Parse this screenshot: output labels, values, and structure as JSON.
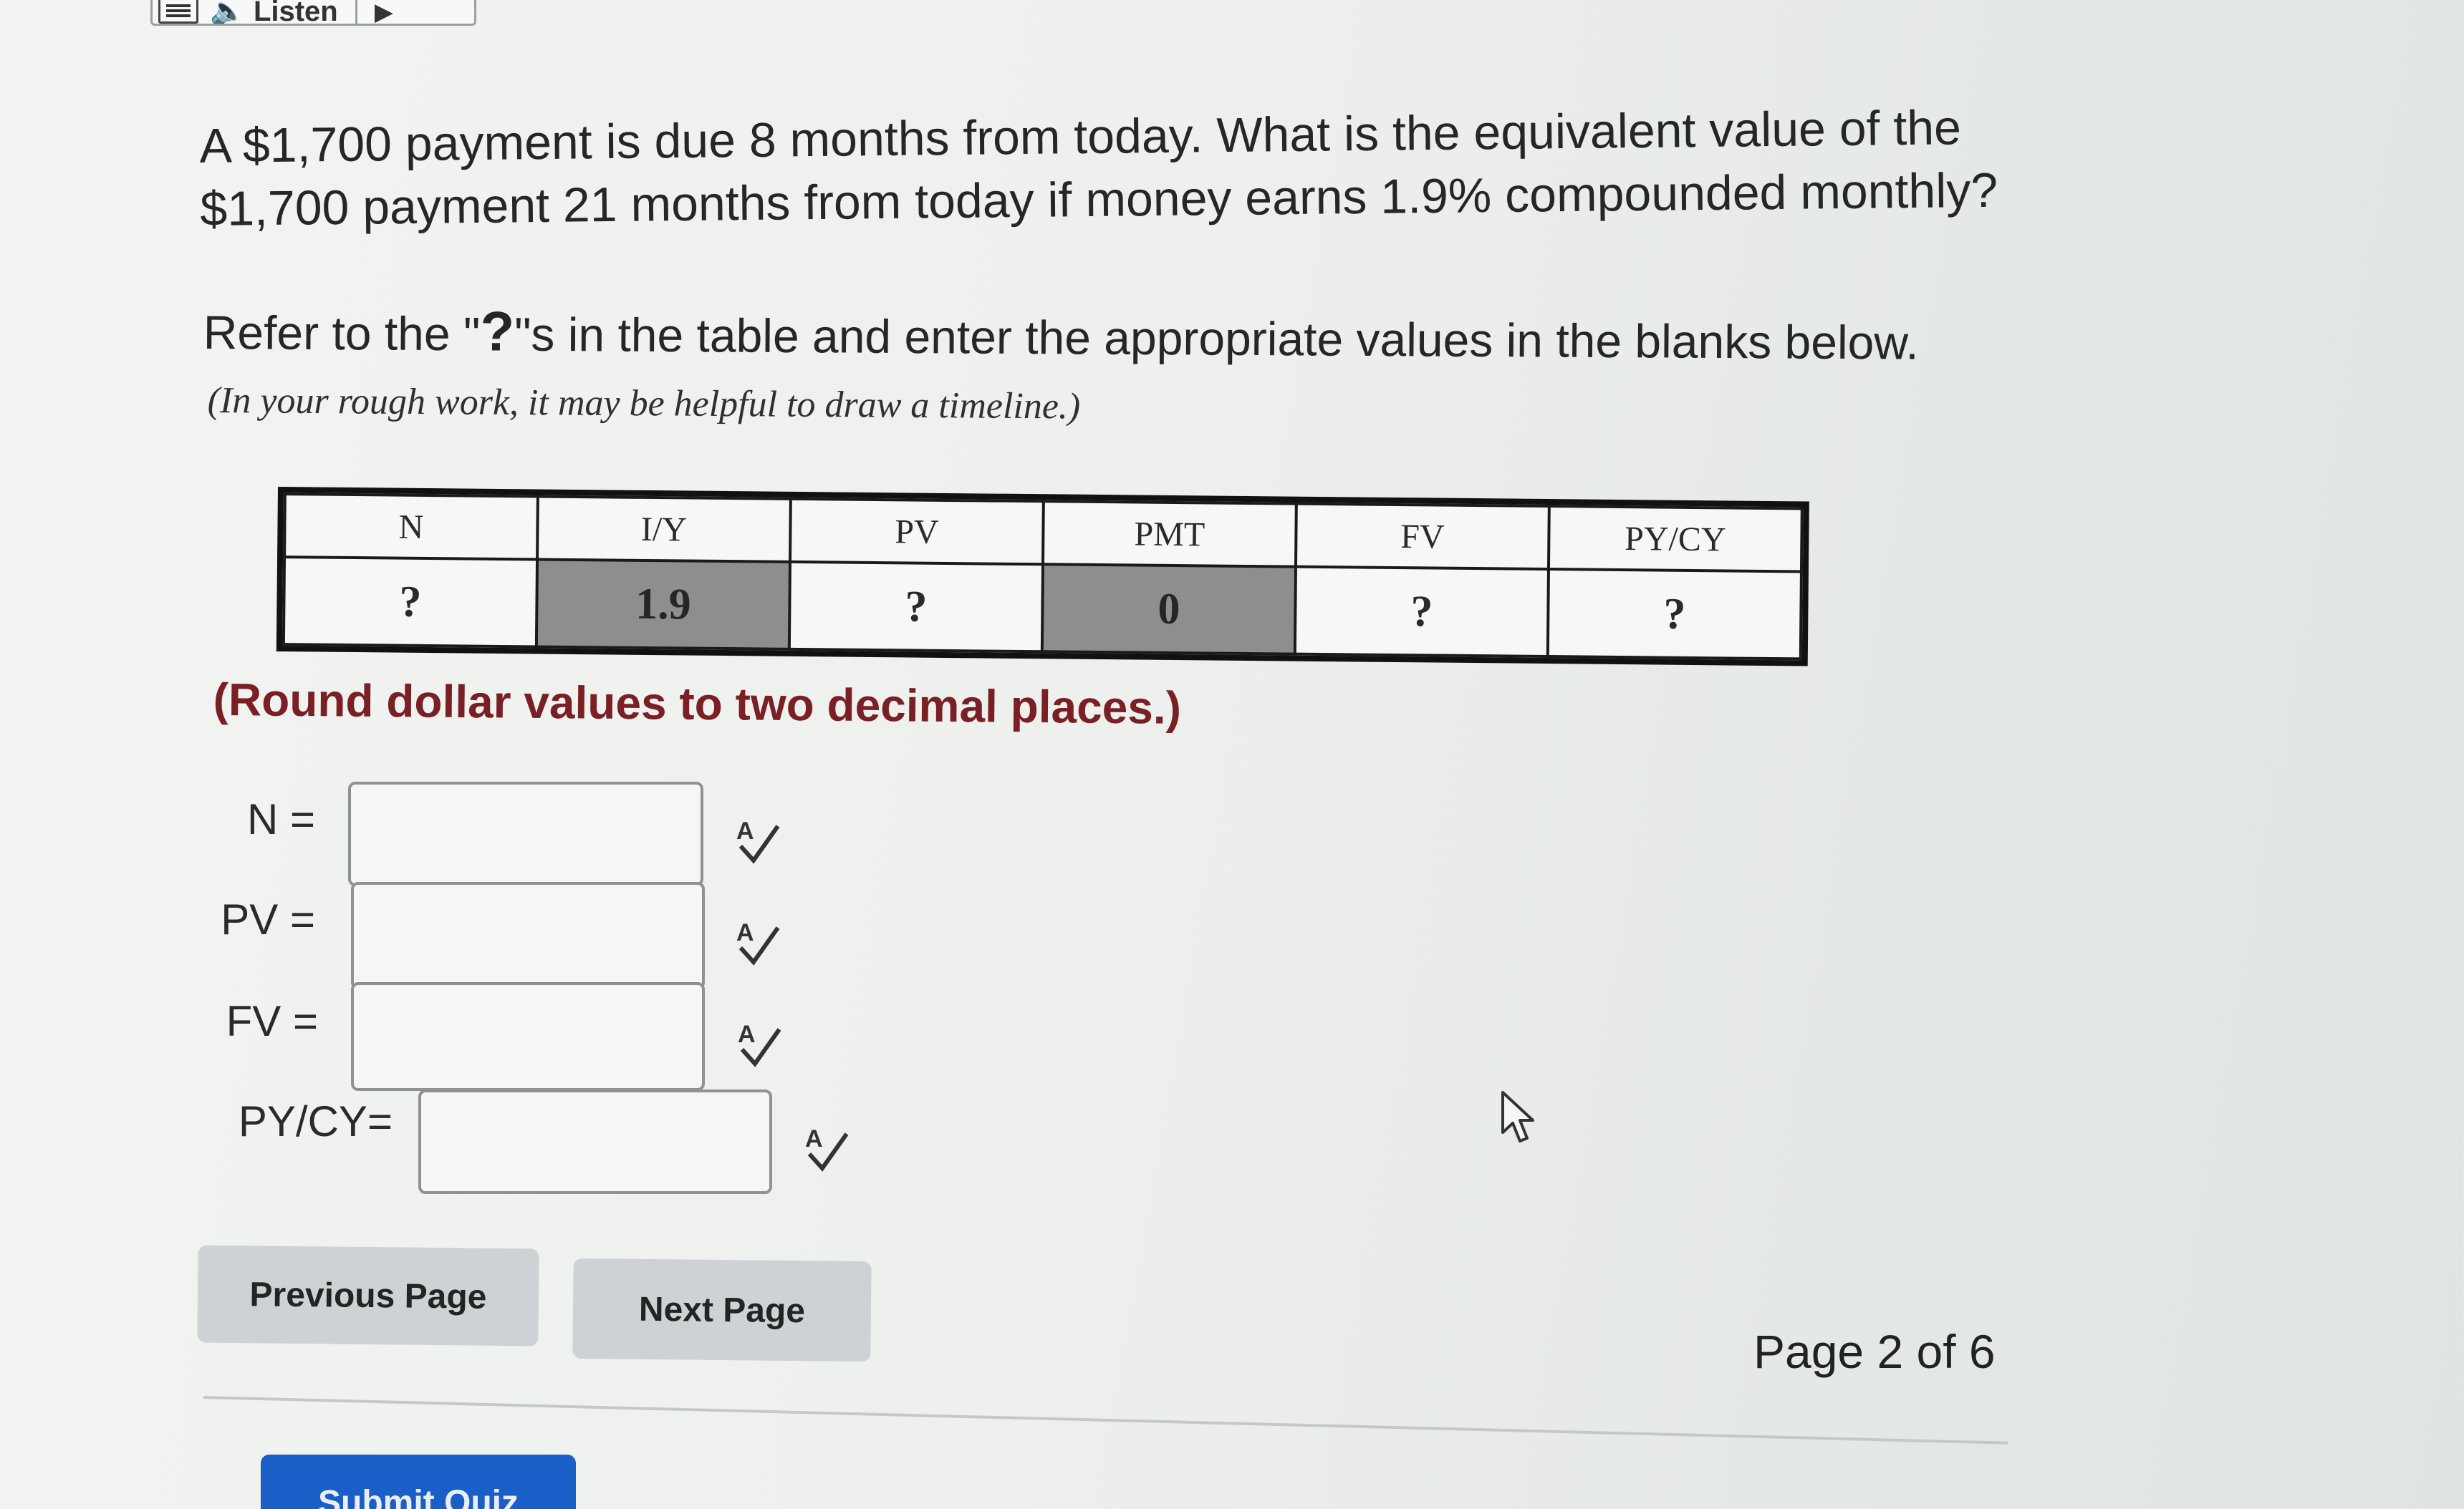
{
  "toolbar": {
    "listen_label": "Listen",
    "menu_icon": "menu-icon",
    "speaker_icon": "speaker-icon",
    "play_icon": "play-icon"
  },
  "question": {
    "line1": "A $1,700 payment is due 8 months from today. What is the equivalent value of the",
    "line2": "$1,700 payment 21 months from today if money earns 1.9% compounded monthly?"
  },
  "instruction": {
    "before": "Refer to the \"",
    "mark": "?",
    "after": "\"s in the table and enter the appropriate values in the blanks below."
  },
  "hint": "(In your rough work, it may be helpful to draw a timeline.)",
  "tvm_table": {
    "headers": [
      "N",
      "I/Y",
      "PV",
      "PMT",
      "FV",
      "PY/CY"
    ],
    "values": [
      "?",
      "1.9",
      "?",
      "0",
      "?",
      "?"
    ]
  },
  "round_note": "(Round dollar values to two decimal places.)",
  "answers": [
    {
      "label": "N =",
      "value": ""
    },
    {
      "label": "PV =",
      "value": ""
    },
    {
      "label": "FV =",
      "value": ""
    },
    {
      "label": "PY/CY=",
      "value": ""
    }
  ],
  "nav": {
    "previous_label": "Previous Page",
    "next_label": "Next Page",
    "page_indicator": "Page 2 of 6",
    "submit_label": "Submit Quiz"
  },
  "colors": {
    "note_red": "#7a1f24",
    "submit_blue": "#1a5ec8",
    "shaded_cell": "#8e8e8e"
  }
}
